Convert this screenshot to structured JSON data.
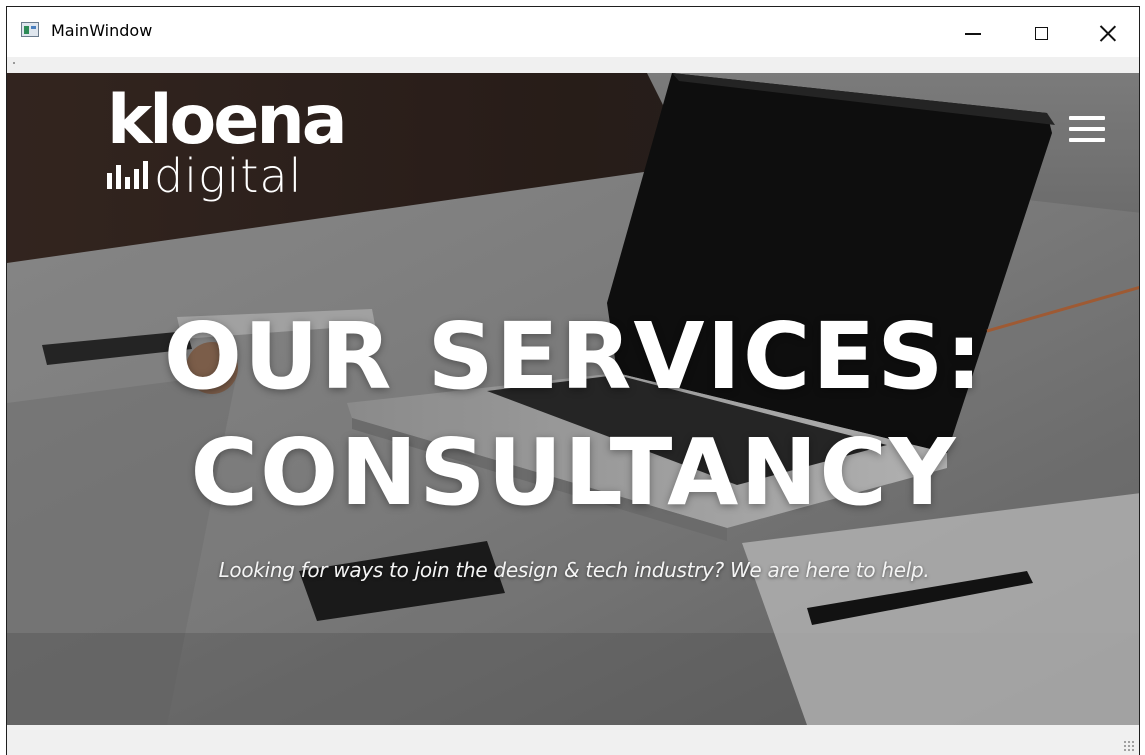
{
  "window": {
    "title": "MainWindow",
    "controls": {
      "minimize": "minimize-icon",
      "maximize": "maximize-icon",
      "close": "close-icon"
    }
  },
  "page": {
    "logo": {
      "word": "kloena",
      "sub": "digital"
    },
    "menu_icon": "hamburger-menu-icon",
    "headline_line1": "OUR SERVICES:",
    "headline_line2": "CONSULTANCY",
    "tagline": "Looking for ways to join the design & tech industry? We are here to help."
  },
  "colors": {
    "text_on_hero": "#ffffff",
    "window_chrome": "#f0f0f0",
    "titlebar": "#ffffff"
  }
}
